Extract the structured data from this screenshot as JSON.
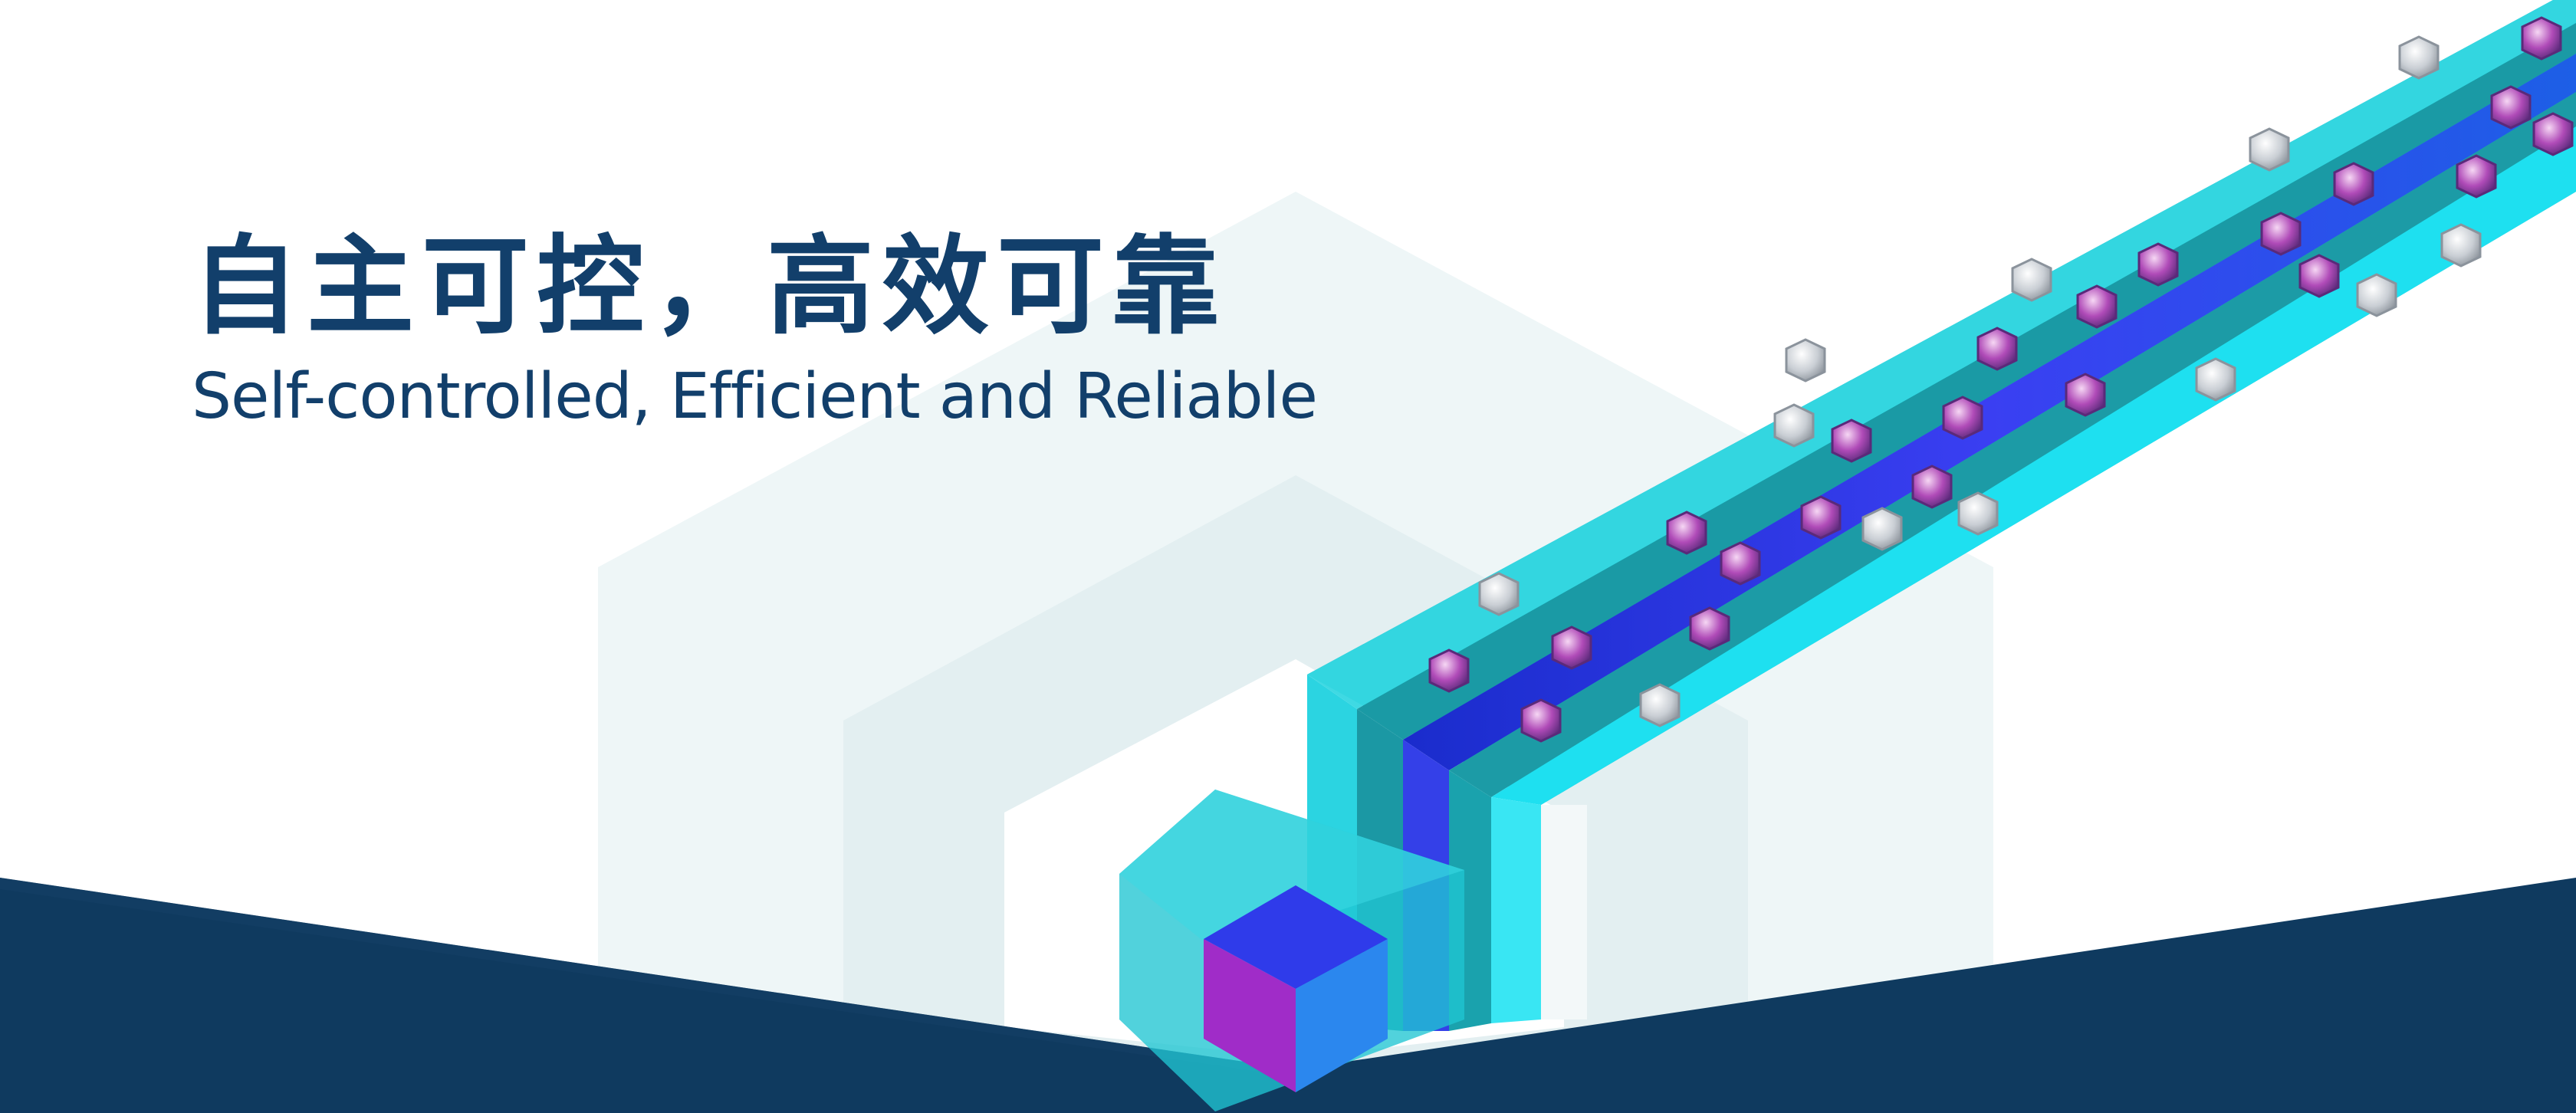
{
  "banner": {
    "headline_zh": "自主可控，高效可靠",
    "headline_en": "Self-controlled, Efficient and Reliable",
    "icons": [
      "hexagon-backdrop-icon",
      "data-bus-icon",
      "chip-cube-icon",
      "bolt-icon"
    ]
  },
  "colors": {
    "headline": "#123f6b",
    "footer_navy": "#0f3a5f",
    "hex_backdrop": "#eef6f7",
    "teal": "#1fc3cf",
    "deep_teal": "#0f8f98",
    "blue_channel": "#2233e8",
    "cyan_glow": "#23e6f4",
    "cube_blue": "#2f3bea",
    "cube_magenta": "#a02cc8",
    "cube_light_blue": "#2b87ee",
    "bolt_silver": "#d8dde2",
    "bolt_magenta": "#c34fc0"
  }
}
